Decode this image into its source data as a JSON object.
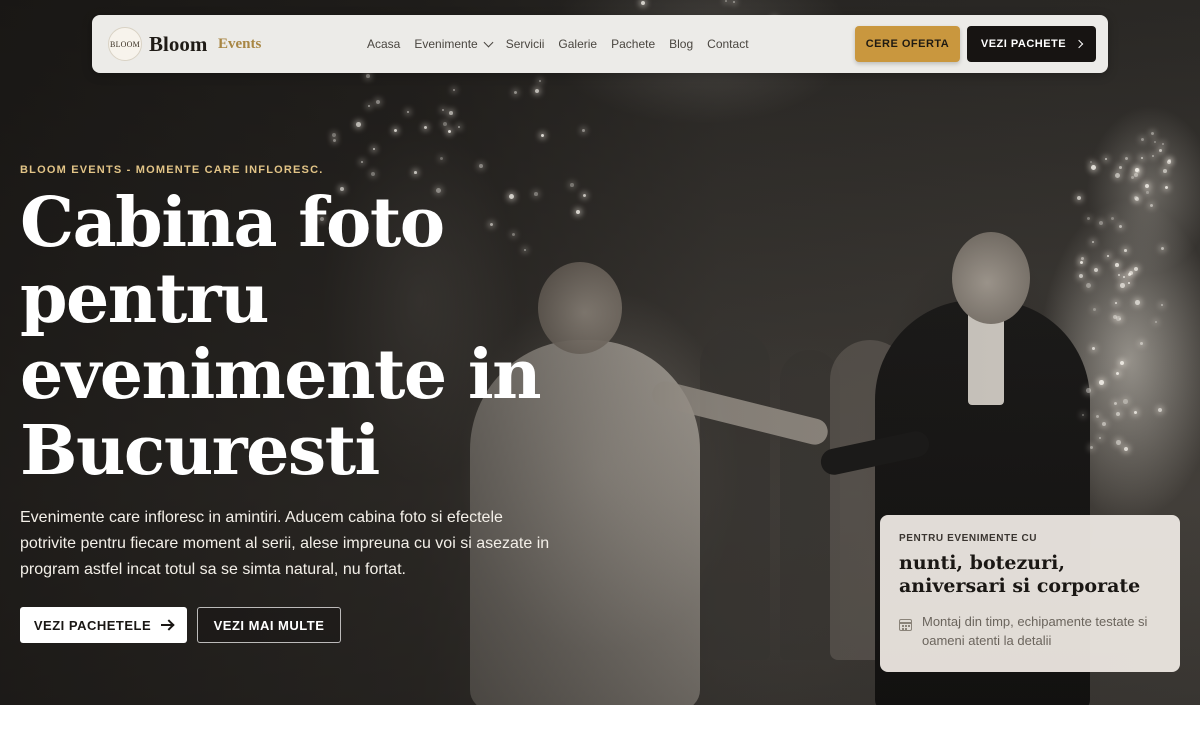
{
  "brand": {
    "logo_text": "BLOOM",
    "name": "Bloom",
    "suffix": "Events"
  },
  "nav": {
    "links": [
      {
        "label": "Acasa"
      },
      {
        "label": "Evenimente",
        "has_dropdown": true
      },
      {
        "label": "Servicii"
      },
      {
        "label": "Galerie"
      },
      {
        "label": "Pachete"
      },
      {
        "label": "Blog"
      },
      {
        "label": "Contact"
      }
    ],
    "cta_offer": "CERE OFERTA",
    "cta_packages": "VEZI PACHETE"
  },
  "hero": {
    "eyebrow": "BLOOM EVENTS - MOMENTE CARE INFLORESC.",
    "title": "Cabina foto pentru evenimente in Bucuresti",
    "description": "Evenimente care infloresc in amintiri. Aducem cabina foto si efectele potrivite pentru fiecare moment al serii, alese impreuna cu voi si asezate in program astfel incat totul sa se simta natural, nu fortat.",
    "primary_button": "VEZI PACHETELE",
    "secondary_button": "VEZI MAI MULTE"
  },
  "info_card": {
    "eyebrow": "PENTRU EVENIMENTE CU",
    "title": "nunti, botezuri, aniversari si corporate",
    "text": "Montaj din timp, echipamente testate si oameni atenti la detalii",
    "icon": "calendar-icon"
  },
  "colors": {
    "accent_gold": "#c9973e",
    "brand_gold": "#a88643",
    "dark": "#171412",
    "eyebrow_gold": "#e2c487"
  }
}
